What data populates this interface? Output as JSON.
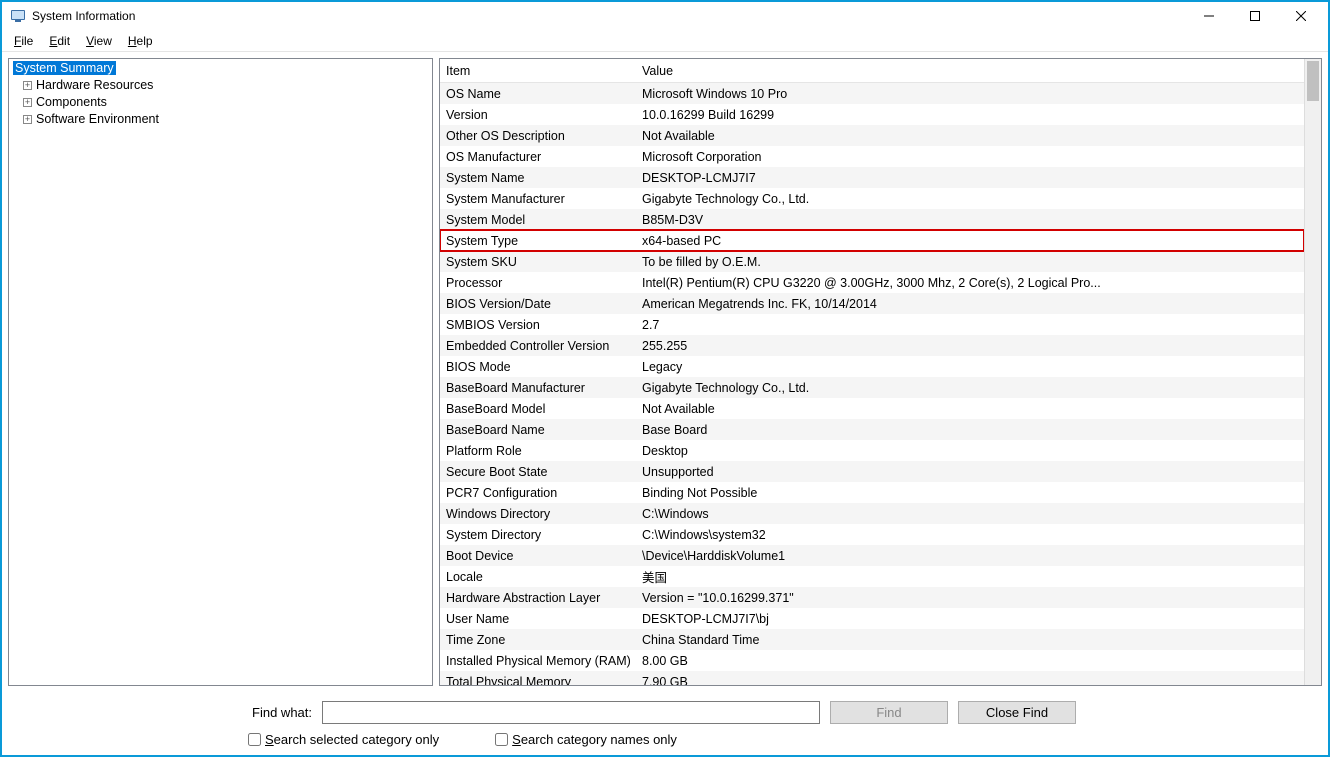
{
  "window": {
    "title": "System Information"
  },
  "menu": {
    "file": "File",
    "edit": "Edit",
    "view": "View",
    "help": "Help"
  },
  "tree": {
    "root": "System Summary",
    "children": [
      "Hardware Resources",
      "Components",
      "Software Environment"
    ]
  },
  "columns": {
    "item": "Item",
    "value": "Value"
  },
  "details": [
    {
      "item": "OS Name",
      "value": "Microsoft Windows 10 Pro"
    },
    {
      "item": "Version",
      "value": "10.0.16299 Build 16299"
    },
    {
      "item": "Other OS Description",
      "value": "Not Available"
    },
    {
      "item": "OS Manufacturer",
      "value": "Microsoft Corporation"
    },
    {
      "item": "System Name",
      "value": "DESKTOP-LCMJ7I7"
    },
    {
      "item": "System Manufacturer",
      "value": "Gigabyte Technology Co., Ltd."
    },
    {
      "item": "System Model",
      "value": "B85M-D3V"
    },
    {
      "item": "System Type",
      "value": "x64-based PC",
      "highlight": true
    },
    {
      "item": "System SKU",
      "value": "To be filled by O.E.M."
    },
    {
      "item": "Processor",
      "value": "Intel(R) Pentium(R) CPU G3220 @ 3.00GHz, 3000 Mhz, 2 Core(s), 2 Logical Pro..."
    },
    {
      "item": "BIOS Version/Date",
      "value": "American Megatrends Inc. FK, 10/14/2014"
    },
    {
      "item": "SMBIOS Version",
      "value": "2.7"
    },
    {
      "item": "Embedded Controller Version",
      "value": "255.255"
    },
    {
      "item": "BIOS Mode",
      "value": "Legacy"
    },
    {
      "item": "BaseBoard Manufacturer",
      "value": "Gigabyte Technology Co., Ltd."
    },
    {
      "item": "BaseBoard Model",
      "value": "Not Available"
    },
    {
      "item": "BaseBoard Name",
      "value": "Base Board"
    },
    {
      "item": "Platform Role",
      "value": "Desktop"
    },
    {
      "item": "Secure Boot State",
      "value": "Unsupported"
    },
    {
      "item": "PCR7 Configuration",
      "value": "Binding Not Possible"
    },
    {
      "item": "Windows Directory",
      "value": "C:\\Windows"
    },
    {
      "item": "System Directory",
      "value": "C:\\Windows\\system32"
    },
    {
      "item": "Boot Device",
      "value": "\\Device\\HarddiskVolume1"
    },
    {
      "item": "Locale",
      "value": "美国"
    },
    {
      "item": "Hardware Abstraction Layer",
      "value": "Version = \"10.0.16299.371\""
    },
    {
      "item": "User Name",
      "value": "DESKTOP-LCMJ7I7\\bj"
    },
    {
      "item": "Time Zone",
      "value": "China Standard Time"
    },
    {
      "item": "Installed Physical Memory (RAM)",
      "value": "8.00 GB"
    },
    {
      "item": "Total Physical Memory",
      "value": "7.90 GB"
    }
  ],
  "find": {
    "label": "Find what:",
    "find_btn": "Find",
    "close_btn": "Close Find",
    "chk_selected": "Search selected category only",
    "chk_names": "Search category names only"
  }
}
